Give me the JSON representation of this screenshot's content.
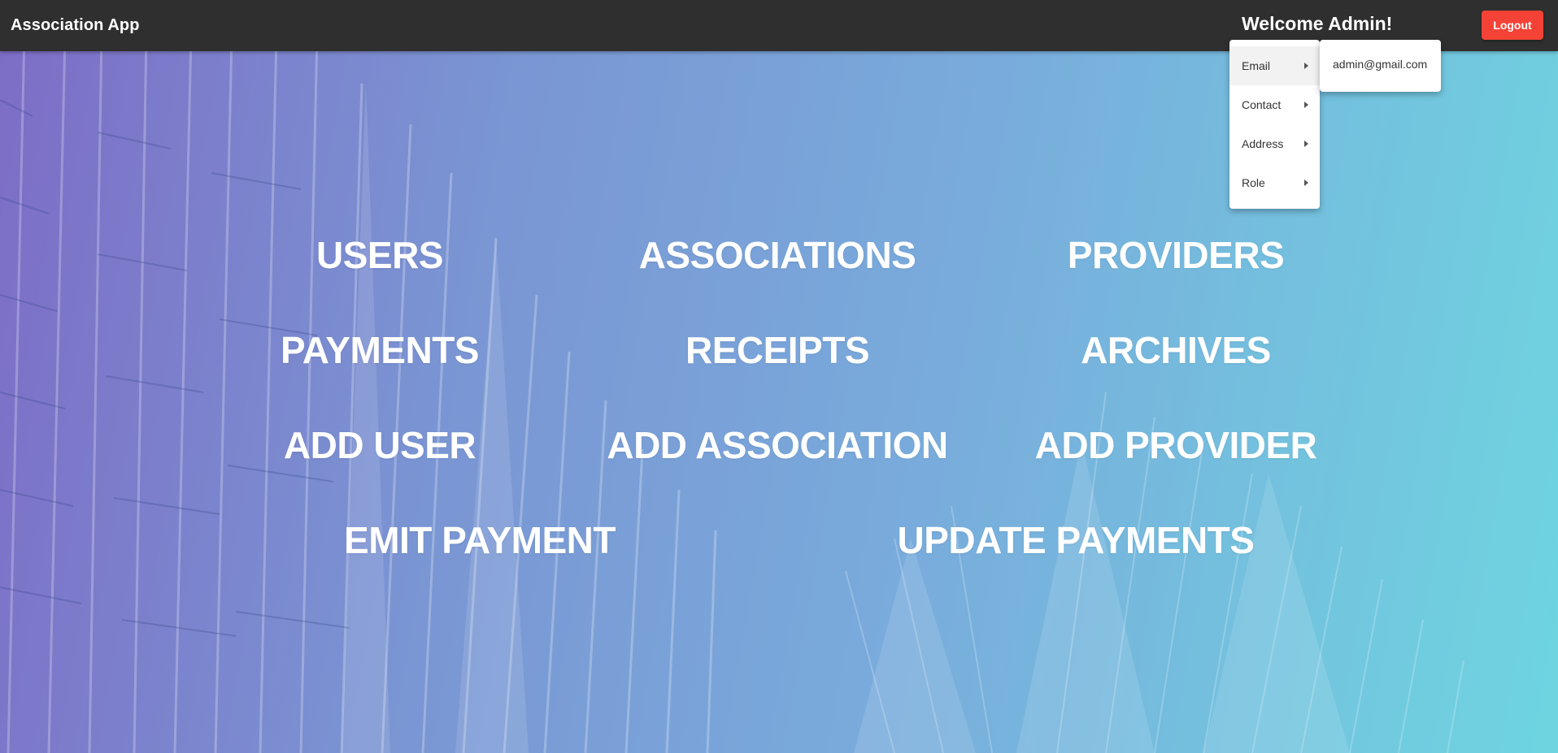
{
  "header": {
    "app_title": "Association App",
    "welcome": "Welcome Admin!",
    "logout_label": "Logout"
  },
  "user_menu": {
    "items": [
      {
        "label": "Email"
      },
      {
        "label": "Contact"
      },
      {
        "label": "Address"
      },
      {
        "label": "Role"
      }
    ],
    "open_submenu": {
      "parent": "Email",
      "value": "admin@gmail.com"
    }
  },
  "nav": {
    "users": "USERS",
    "associations": "ASSOCIATIONS",
    "providers": "PROVIDERS",
    "payments": "PAYMENTS",
    "receipts": "RECEIPTS",
    "archives": "ARCHIVES",
    "add_user": "ADD USER",
    "add_association": "ADD ASSOCIATION",
    "add_provider": "ADD PROVIDER",
    "emit_payment": "EMIT PAYMENT",
    "update_payments": "UPDATE PAYMENTS"
  },
  "colors": {
    "topbar": "#2f2f2f",
    "logout_button": "#f44336",
    "gradient_start": "#7d6dc6",
    "gradient_end": "#6ed5e0"
  }
}
